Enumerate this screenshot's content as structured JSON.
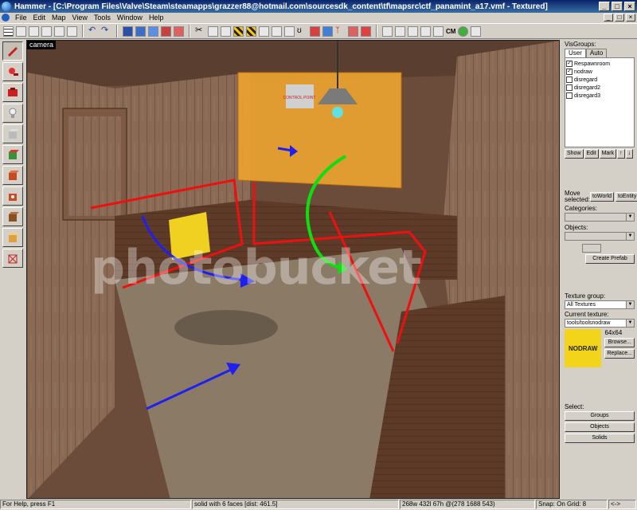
{
  "window": {
    "title": "Hammer - [C:\\Program Files\\Valve\\Steam\\steamapps\\grazzer88@hotmail.com\\sourcesdk_content\\tf\\mapsrc\\ctf_panamint_a17.vmf - Textured]",
    "min": "_",
    "max": "□",
    "close": "×"
  },
  "menu": {
    "items": [
      "File",
      "Edit",
      "Map",
      "View",
      "Tools",
      "Window",
      "Help"
    ]
  },
  "toolbar": {
    "cm_label": "CM"
  },
  "viewport": {
    "label": "camera",
    "watermark": "photobucket",
    "sign_text": "CONTROL POINT"
  },
  "visgroups": {
    "header": "VisGroups:",
    "tab_user": "User",
    "tab_auto": "Auto",
    "items": [
      {
        "label": "Respawnroom",
        "checked": "✓"
      },
      {
        "label": "nodraw",
        "checked": "✓"
      },
      {
        "label": "disregard",
        "checked": ""
      },
      {
        "label": "disregard2",
        "checked": ""
      },
      {
        "label": "disregard3",
        "checked": ""
      }
    ],
    "show": "Show",
    "edit": "Edit",
    "mark": "Mark",
    "up": "↑",
    "down": "↓"
  },
  "move": {
    "label": "Move selected:",
    "to_world": "toWorld",
    "to_entity": "toEntity",
    "categories": "Categories:",
    "objects": "Objects:",
    "create_prefab": "Create Prefab"
  },
  "texture": {
    "group_label": "Texture group:",
    "group_value": "All Textures",
    "current_label": "Current texture:",
    "current_value": "tools/toolsnodraw",
    "size": "64x64",
    "preview_text": "NODRAW",
    "browse": "Browse...",
    "replace": "Replace..."
  },
  "select": {
    "label": "Select:",
    "groups": "Groups",
    "objects": "Objects",
    "solids": "Solids"
  },
  "status": {
    "help": "For Help, press F1",
    "selection": "solid with 6 faces  [dist: 461.5]",
    "coords": "268w 432l 67h @(278 1688 543)",
    "snap": "Snap: On Grid: 8",
    "extra": "<->"
  }
}
